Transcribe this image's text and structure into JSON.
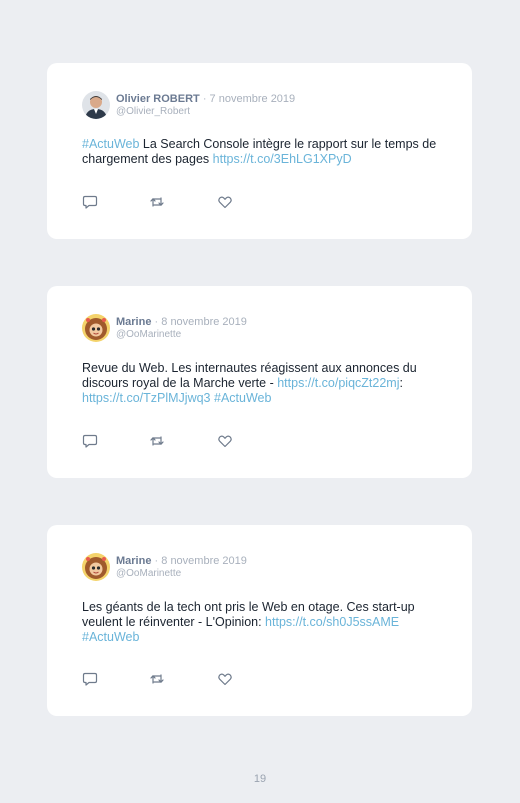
{
  "tweets": [
    {
      "name": "Olivier ROBERT",
      "separator": "·",
      "date": "7 novembre 2019",
      "handle": "@Olivier_Robert",
      "text": {
        "hashtag_start": "#ActuWeb",
        "part1": " La Search Console intègre le rapport sur le temps de chargement des pages ",
        "link1": "https://t.co/3EhLG1XPyD"
      }
    },
    {
      "name": "Marine",
      "separator": "·",
      "date": "8 novembre 2019",
      "handle": "@OoMarinette",
      "text": {
        "part1": "Revue du Web. Les internautes réagissent aux annonces du discours royal de la Marche verte - ",
        "link1": "https://t.co/piqcZt22mj",
        "part2": ": ",
        "link2": "https://t.co/TzPlMJjwq3",
        "part3": " ",
        "hashtag_end": "#ActuWeb"
      }
    },
    {
      "name": "Marine",
      "separator": "·",
      "date": "8 novembre 2019",
      "handle": "@OoMarinette",
      "text": {
        "part1": "Les géants de la tech ont pris le Web en otage. Ces start-up veulent le réinventer - L'Opinion: ",
        "link1": "https://t.co/sh0J5ssAME",
        "part2": " ",
        "hashtag_end": "#ActuWeb"
      }
    }
  ],
  "page_number": "19",
  "colors": {
    "background": "#eceef2",
    "card": "#ffffff",
    "link": "#6ab4d9",
    "text": "#1b2430",
    "icon": "#6f7b8c"
  },
  "icons": [
    "reply-icon",
    "retweet-icon",
    "like-icon"
  ]
}
